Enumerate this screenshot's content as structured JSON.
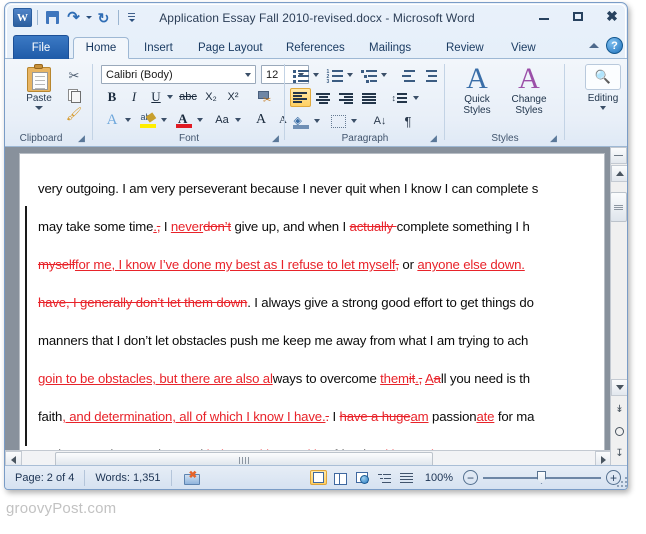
{
  "window": {
    "title": "Application Essay Fall 2010-revised.docx  -  Microsoft Word",
    "minimize_label": "Minimize",
    "maximize_label": "Restore",
    "close_label": "Close"
  },
  "quick_access": {
    "app_icon": "word-icon",
    "app_letter": "W",
    "save": "save-icon",
    "undo": "↶",
    "redo": "↻",
    "customize": "customize-qat-icon"
  },
  "tabs": [
    {
      "label": "File",
      "active": false,
      "is_file": true
    },
    {
      "label": "Home",
      "active": true,
      "is_file": false
    },
    {
      "label": "Insert",
      "active": false,
      "is_file": false
    },
    {
      "label": "Page Layout",
      "active": false,
      "is_file": false
    },
    {
      "label": "References",
      "active": false,
      "is_file": false
    },
    {
      "label": "Mailings",
      "active": false,
      "is_file": false
    },
    {
      "label": "Review",
      "active": false,
      "is_file": false
    },
    {
      "label": "View",
      "active": false,
      "is_file": false
    }
  ],
  "ribbon_help": {
    "minimize_ribbon": "chevron-up-icon",
    "help": "?"
  },
  "ribbon": {
    "groups": [
      {
        "name": "Clipboard",
        "label": "Clipboard"
      },
      {
        "name": "Font",
        "label": "Font"
      },
      {
        "name": "Paragraph",
        "label": "Paragraph"
      },
      {
        "name": "Styles",
        "label": "Styles"
      },
      {
        "name": "Editing",
        "label": ""
      }
    ],
    "clipboard": {
      "paste_label": "Paste",
      "cut": "✂",
      "copy": "copy-icon",
      "format_painter": "🖌"
    },
    "font": {
      "font_name": "Calibri (Body)",
      "font_size": "12",
      "bold": "B",
      "italic": "I",
      "underline": "U",
      "strikethrough": "abc",
      "subscript": "X₂",
      "superscript": "X²",
      "clear_formatting": "clear-formatting-icon",
      "text_effects": "A",
      "highlight": "highlight-icon",
      "font_color": "A",
      "change_case": "Aa",
      "grow_font": "A",
      "shrink_font": "A"
    },
    "paragraph": {
      "bullets": "bullets-icon",
      "numbering": "numbering-icon",
      "multilevel": "multilevel-list-icon",
      "decrease_indent": "decrease-indent-icon",
      "increase_indent": "increase-indent-icon",
      "align_left": "align-left-icon",
      "center": "align-center-icon",
      "align_right": "align-right-icon",
      "justify": "justify-icon",
      "line_spacing": "line-spacing-icon",
      "shading": "shading-icon",
      "borders": "borders-icon",
      "sort": "A↓",
      "show_marks": "¶"
    },
    "styles": {
      "quick_styles_line1": "Quick",
      "quick_styles_line2": "Styles",
      "change_styles_line1": "Change",
      "change_styles_line2": "Styles"
    },
    "editing": {
      "label": "Editing",
      "icon": "binoculars-icon"
    }
  },
  "document": {
    "lines": [
      {
        "id": "line-1",
        "runs": [
          {
            "t": "very outgoing. I am very perseverant because I never quit when I know I can complete s",
            "k": "n"
          }
        ]
      },
      {
        "id": "line-2",
        "runs": [
          {
            "t": "may take some time",
            "k": "n"
          },
          {
            "t": ".",
            "k": "ins"
          },
          {
            "t": ",",
            "k": "del"
          },
          {
            "t": " I ",
            "k": "n"
          },
          {
            "t": "never",
            "k": "ins"
          },
          {
            "t": "don’t",
            "k": "del"
          },
          {
            "t": " give up, and when I ",
            "k": "n"
          },
          {
            "t": "actually ",
            "k": "del"
          },
          {
            "t": "complete something I h",
            "k": "n"
          }
        ]
      },
      {
        "id": "line-3",
        "runs": [
          {
            "t": "myself",
            "k": "del"
          },
          {
            "t": "for me, I know I’ve done my best as I refuse to let myself",
            "k": "ins"
          },
          {
            "t": ",",
            "k": "del"
          },
          {
            "t": " or ",
            "k": "n"
          },
          {
            "t": "anyone else down. ",
            "k": "ins"
          }
        ]
      },
      {
        "id": "line-4",
        "runs": [
          {
            "t": "have, I generally don’t let them down",
            "k": "del"
          },
          {
            "t": ". I always give a strong good effort to get things do",
            "k": "n"
          }
        ]
      },
      {
        "id": "line-5",
        "runs": [
          {
            "t": "manners that I don’t let obstacles push me keep me away from what I am trying to ach",
            "k": "n"
          }
        ]
      },
      {
        "id": "line-6",
        "runs": [
          {
            "t": "goin to be obstacles, but there are also  al",
            "k": "ins"
          },
          {
            "t": "ways to overcome ",
            "k": "n"
          },
          {
            "t": "them",
            "k": "ins"
          },
          {
            "t": "it",
            "k": "del"
          },
          {
            "t": ".",
            "k": "ins"
          },
          {
            "t": ",",
            "k": "del"
          },
          {
            "t": " ",
            "k": "n"
          },
          {
            "t": "A",
            "k": "ins"
          },
          {
            "t": "a",
            "k": "del"
          },
          {
            "t": "ll you need is th",
            "k": "n"
          }
        ]
      },
      {
        "id": "line-7",
        "runs": [
          {
            "t": "faith",
            "k": "n"
          },
          {
            "t": ", and determination, all of which I know I have.",
            "k": "ins"
          },
          {
            "t": ".",
            "k": "del"
          },
          {
            "t": " I ",
            "k": "n"
          },
          {
            "t": "have a huge",
            "k": "del"
          },
          {
            "t": "am",
            "k": "ins"
          },
          {
            "t": " passion",
            "k": "n"
          },
          {
            "t": "ate",
            "k": "ins"
          },
          {
            "t": " for ma",
            "k": "n"
          }
        ]
      },
      {
        "id": "line-8",
        "runs": [
          {
            "t": "such as music, exercise, and ",
            "k": "n"
          },
          {
            "t": "being ",
            "k": "del"
          },
          {
            "t": "making positive ",
            "k": "ins"
          },
          {
            "t": "friends",
            "k": "n"
          },
          {
            "t": " with people",
            "k": "del"
          },
          {
            "t": ". I am very easy t",
            "k": "n"
          }
        ]
      }
    ]
  },
  "status_bar": {
    "page": "Page: 2 of 4",
    "words": "Words: 1,351",
    "proofing_icon": "proofing-errors-icon",
    "zoom_level": "100%",
    "zoom_out": "−",
    "zoom_in": "+",
    "views": [
      {
        "name": "print-layout",
        "selected": true
      },
      {
        "name": "full-screen-reading",
        "selected": false
      },
      {
        "name": "web-layout",
        "selected": false
      },
      {
        "name": "outline",
        "selected": false
      },
      {
        "name": "draft",
        "selected": false
      }
    ]
  },
  "scrollbars": {
    "select_browse_object": "select-browse-object-icon",
    "previous_page": "previous-page-icon",
    "next_page": "next-page-icon"
  },
  "watermark": {
    "text": "groovyPost.com"
  },
  "colors": {
    "tracked_change": "#e8232a",
    "ribbon_accent": "#2c5f9e",
    "highlight": "#ffd063"
  }
}
